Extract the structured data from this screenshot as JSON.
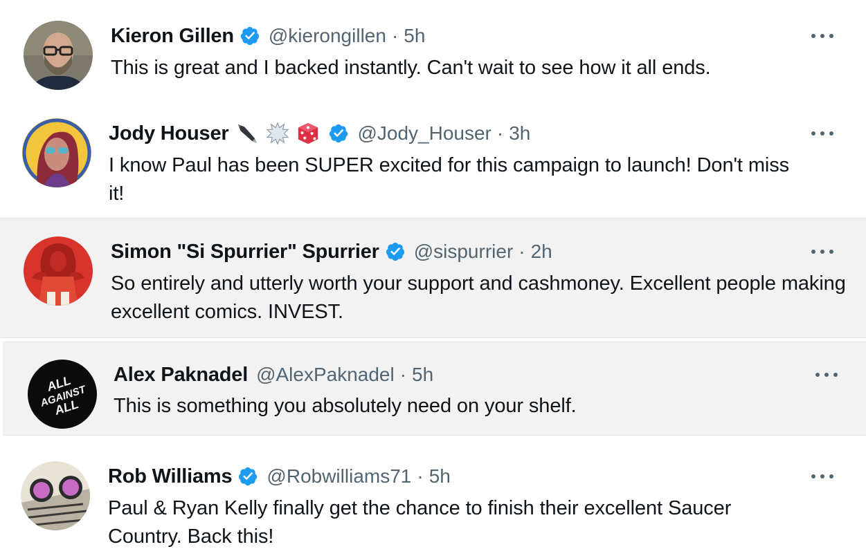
{
  "tweets": [
    {
      "name": "Kieron Gillen",
      "handle": "@kierongillen",
      "separator": "·",
      "time": "5h",
      "verified": true,
      "text": "This is great and I backed instantly. Can't wait to see how it all ends."
    },
    {
      "name": "Jody Houser",
      "handle": "@Jody_Houser",
      "separator": "·",
      "time": "3h",
      "verified": true,
      "emojis": [
        "fountain-pen-icon",
        "speech-burst-icon",
        "die-icon"
      ],
      "text": "I know Paul has been SUPER excited for this campaign to launch! Don't miss it!"
    },
    {
      "name": "Simon \"Si Spurrier\" Spurrier",
      "handle": "@sispurrier",
      "separator": "·",
      "time": "2h",
      "verified": true,
      "text": "So entirely and utterly worth your support and cashmoney. Excellent people making excellent comics. INVEST."
    },
    {
      "name": "Alex Paknadel",
      "handle": "@AlexPaknadel",
      "separator": "·",
      "time": "5h",
      "verified": false,
      "avatar_text": "ALL AGAINST ALL",
      "text": "This is something you absolutely need on your shelf."
    },
    {
      "name": "Rob Williams",
      "handle": "@Robwilliams71",
      "separator": "·",
      "time": "5h",
      "verified": true,
      "text": "Paul & Ryan Kelly finally get the chance to finish their excellent Saucer Country. Back this!"
    }
  ],
  "colors": {
    "verified_blue": "#1d9bf0",
    "muted_text": "#536471",
    "shaded_bg": "#f2f2f3"
  }
}
